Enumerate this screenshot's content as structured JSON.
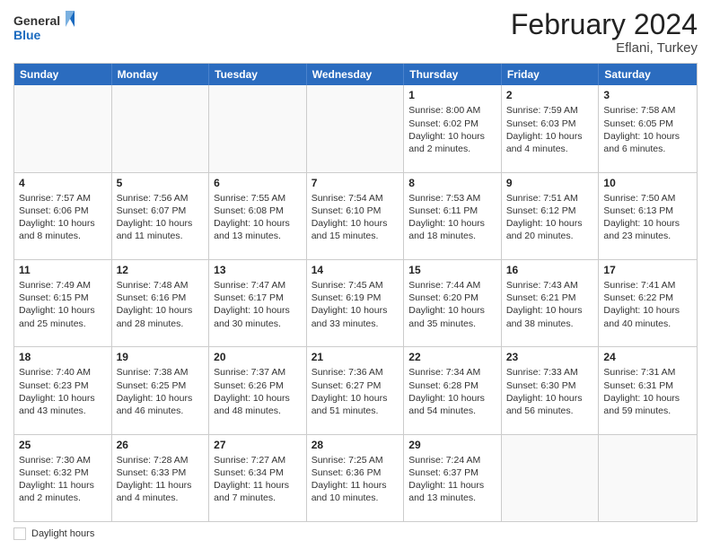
{
  "header": {
    "logo_line1": "General",
    "logo_line2": "Blue",
    "title": "February 2024",
    "subtitle": "Eflani, Turkey"
  },
  "weekdays": [
    "Sunday",
    "Monday",
    "Tuesday",
    "Wednesday",
    "Thursday",
    "Friday",
    "Saturday"
  ],
  "weeks": [
    [
      {
        "day": "",
        "info": ""
      },
      {
        "day": "",
        "info": ""
      },
      {
        "day": "",
        "info": ""
      },
      {
        "day": "",
        "info": ""
      },
      {
        "day": "1",
        "info": "Sunrise: 8:00 AM\nSunset: 6:02 PM\nDaylight: 10 hours and 2 minutes."
      },
      {
        "day": "2",
        "info": "Sunrise: 7:59 AM\nSunset: 6:03 PM\nDaylight: 10 hours and 4 minutes."
      },
      {
        "day": "3",
        "info": "Sunrise: 7:58 AM\nSunset: 6:05 PM\nDaylight: 10 hours and 6 minutes."
      }
    ],
    [
      {
        "day": "4",
        "info": "Sunrise: 7:57 AM\nSunset: 6:06 PM\nDaylight: 10 hours and 8 minutes."
      },
      {
        "day": "5",
        "info": "Sunrise: 7:56 AM\nSunset: 6:07 PM\nDaylight: 10 hours and 11 minutes."
      },
      {
        "day": "6",
        "info": "Sunrise: 7:55 AM\nSunset: 6:08 PM\nDaylight: 10 hours and 13 minutes."
      },
      {
        "day": "7",
        "info": "Sunrise: 7:54 AM\nSunset: 6:10 PM\nDaylight: 10 hours and 15 minutes."
      },
      {
        "day": "8",
        "info": "Sunrise: 7:53 AM\nSunset: 6:11 PM\nDaylight: 10 hours and 18 minutes."
      },
      {
        "day": "9",
        "info": "Sunrise: 7:51 AM\nSunset: 6:12 PM\nDaylight: 10 hours and 20 minutes."
      },
      {
        "day": "10",
        "info": "Sunrise: 7:50 AM\nSunset: 6:13 PM\nDaylight: 10 hours and 23 minutes."
      }
    ],
    [
      {
        "day": "11",
        "info": "Sunrise: 7:49 AM\nSunset: 6:15 PM\nDaylight: 10 hours and 25 minutes."
      },
      {
        "day": "12",
        "info": "Sunrise: 7:48 AM\nSunset: 6:16 PM\nDaylight: 10 hours and 28 minutes."
      },
      {
        "day": "13",
        "info": "Sunrise: 7:47 AM\nSunset: 6:17 PM\nDaylight: 10 hours and 30 minutes."
      },
      {
        "day": "14",
        "info": "Sunrise: 7:45 AM\nSunset: 6:19 PM\nDaylight: 10 hours and 33 minutes."
      },
      {
        "day": "15",
        "info": "Sunrise: 7:44 AM\nSunset: 6:20 PM\nDaylight: 10 hours and 35 minutes."
      },
      {
        "day": "16",
        "info": "Sunrise: 7:43 AM\nSunset: 6:21 PM\nDaylight: 10 hours and 38 minutes."
      },
      {
        "day": "17",
        "info": "Sunrise: 7:41 AM\nSunset: 6:22 PM\nDaylight: 10 hours and 40 minutes."
      }
    ],
    [
      {
        "day": "18",
        "info": "Sunrise: 7:40 AM\nSunset: 6:23 PM\nDaylight: 10 hours and 43 minutes."
      },
      {
        "day": "19",
        "info": "Sunrise: 7:38 AM\nSunset: 6:25 PM\nDaylight: 10 hours and 46 minutes."
      },
      {
        "day": "20",
        "info": "Sunrise: 7:37 AM\nSunset: 6:26 PM\nDaylight: 10 hours and 48 minutes."
      },
      {
        "day": "21",
        "info": "Sunrise: 7:36 AM\nSunset: 6:27 PM\nDaylight: 10 hours and 51 minutes."
      },
      {
        "day": "22",
        "info": "Sunrise: 7:34 AM\nSunset: 6:28 PM\nDaylight: 10 hours and 54 minutes."
      },
      {
        "day": "23",
        "info": "Sunrise: 7:33 AM\nSunset: 6:30 PM\nDaylight: 10 hours and 56 minutes."
      },
      {
        "day": "24",
        "info": "Sunrise: 7:31 AM\nSunset: 6:31 PM\nDaylight: 10 hours and 59 minutes."
      }
    ],
    [
      {
        "day": "25",
        "info": "Sunrise: 7:30 AM\nSunset: 6:32 PM\nDaylight: 11 hours and 2 minutes."
      },
      {
        "day": "26",
        "info": "Sunrise: 7:28 AM\nSunset: 6:33 PM\nDaylight: 11 hours and 4 minutes."
      },
      {
        "day": "27",
        "info": "Sunrise: 7:27 AM\nSunset: 6:34 PM\nDaylight: 11 hours and 7 minutes."
      },
      {
        "day": "28",
        "info": "Sunrise: 7:25 AM\nSunset: 6:36 PM\nDaylight: 11 hours and 10 minutes."
      },
      {
        "day": "29",
        "info": "Sunrise: 7:24 AM\nSunset: 6:37 PM\nDaylight: 11 hours and 13 minutes."
      },
      {
        "day": "",
        "info": ""
      },
      {
        "day": "",
        "info": ""
      }
    ]
  ],
  "legend": {
    "label": "Daylight hours"
  }
}
